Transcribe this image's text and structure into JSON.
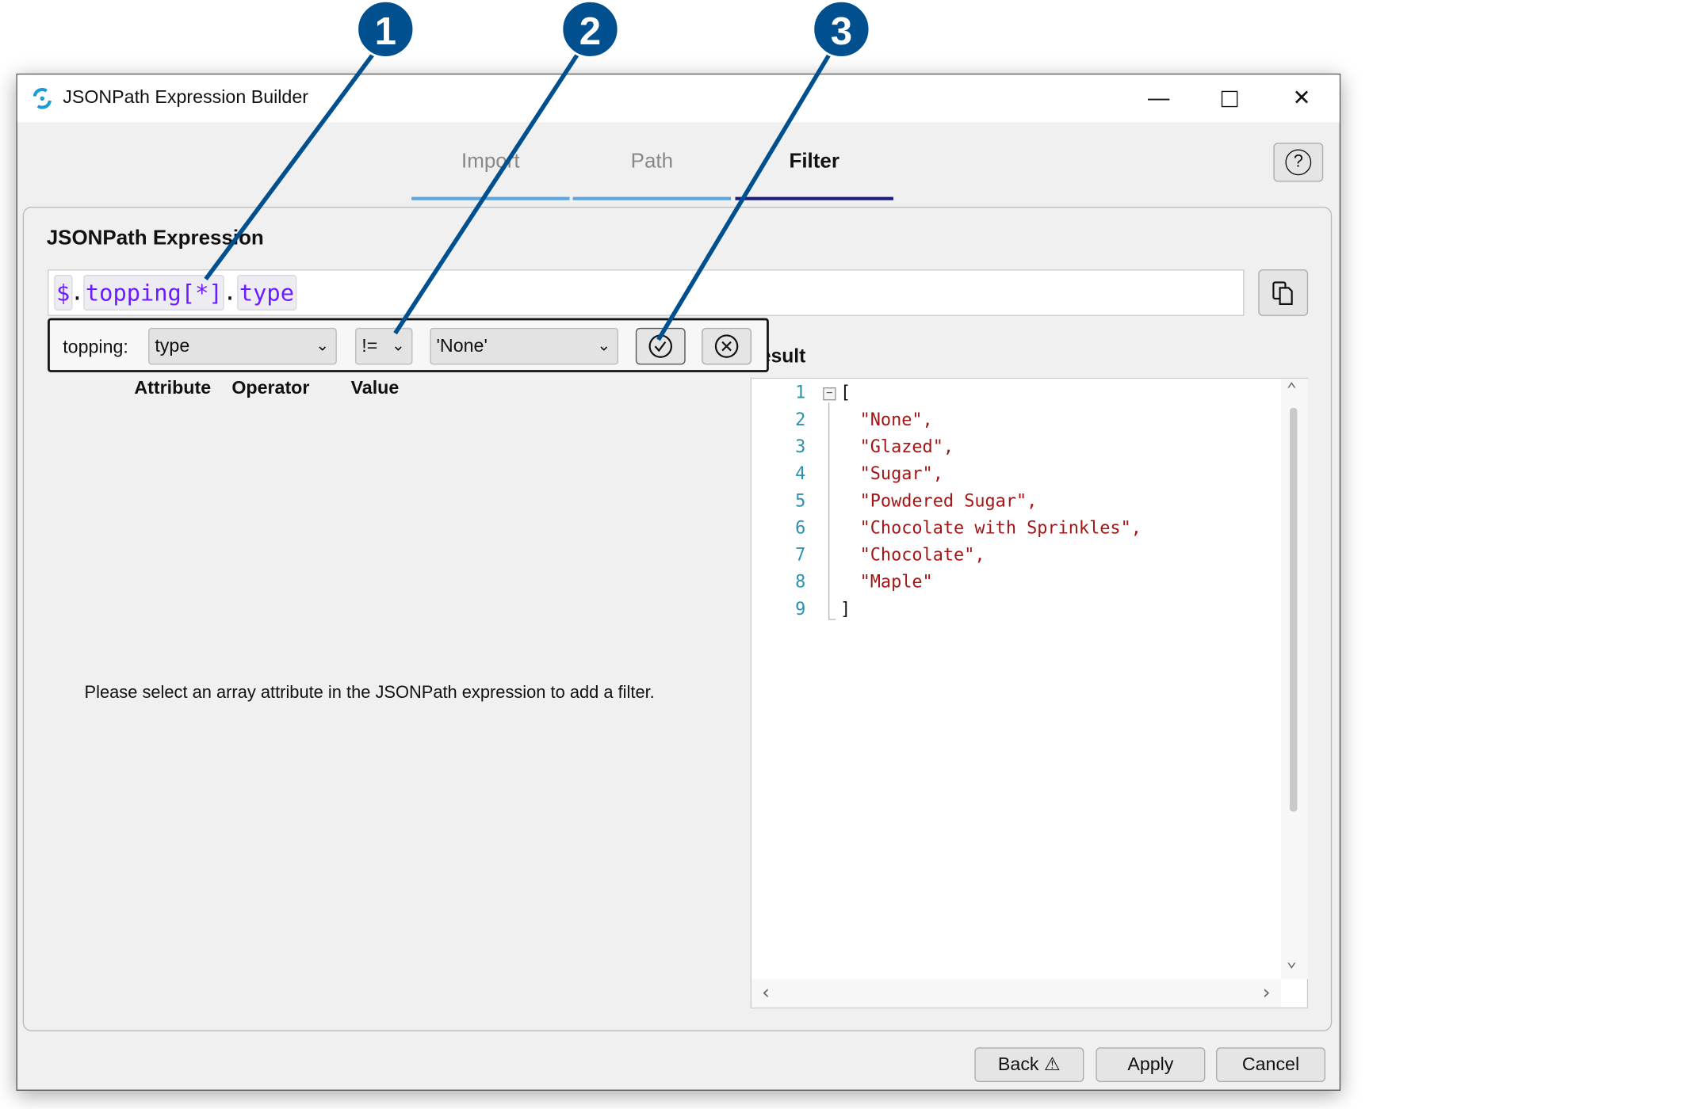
{
  "window": {
    "title": "JSONPath Expression Builder",
    "icon": "jsonpath-logo-icon",
    "controls": [
      "minimize-icon",
      "maximize-icon",
      "close-icon"
    ]
  },
  "tabs": [
    {
      "label": "Import"
    },
    {
      "label": "Path"
    },
    {
      "label": "Filter",
      "active": true
    }
  ],
  "help_icon": "question-circle-icon",
  "expression": {
    "heading": "JSONPath Expression",
    "tokens": [
      "$",
      ".",
      "topping[*]",
      ".",
      "type"
    ],
    "copy_icon": "copy-icon"
  },
  "filter": {
    "prefix": "topping:",
    "attribute": "type",
    "operator": "!=",
    "value": "'None'",
    "apply_icon": "check-circle-icon",
    "remove_icon": "x-circle-icon",
    "labels": {
      "attribute": "Attribute",
      "operator": "Operator",
      "value": "Value"
    }
  },
  "hint": "Please select an array attribute in the JSONPath expression to add a filter.",
  "result": {
    "heading": "Result",
    "lines": [
      {
        "n": "1",
        "text": "["
      },
      {
        "n": "2",
        "text": "\"None\","
      },
      {
        "n": "3",
        "text": "\"Glazed\","
      },
      {
        "n": "4",
        "text": "\"Sugar\","
      },
      {
        "n": "5",
        "text": "\"Powdered Sugar\","
      },
      {
        "n": "6",
        "text": "\"Chocolate with Sprinkles\","
      },
      {
        "n": "7",
        "text": "\"Chocolate\","
      },
      {
        "n": "8",
        "text": "\"Maple\""
      },
      {
        "n": "9",
        "text": "]"
      }
    ]
  },
  "buttons": {
    "back": "Back",
    "apply": "Apply",
    "cancel": "Cancel"
  },
  "callouts": [
    "1",
    "2",
    "3"
  ],
  "colors": {
    "callout": "#00508f",
    "token": "#6a1bff",
    "string": "#a31515",
    "line_number": "#2b91af",
    "active_tab": "#1a1a80",
    "tab_underline": "#5aa5e0"
  }
}
